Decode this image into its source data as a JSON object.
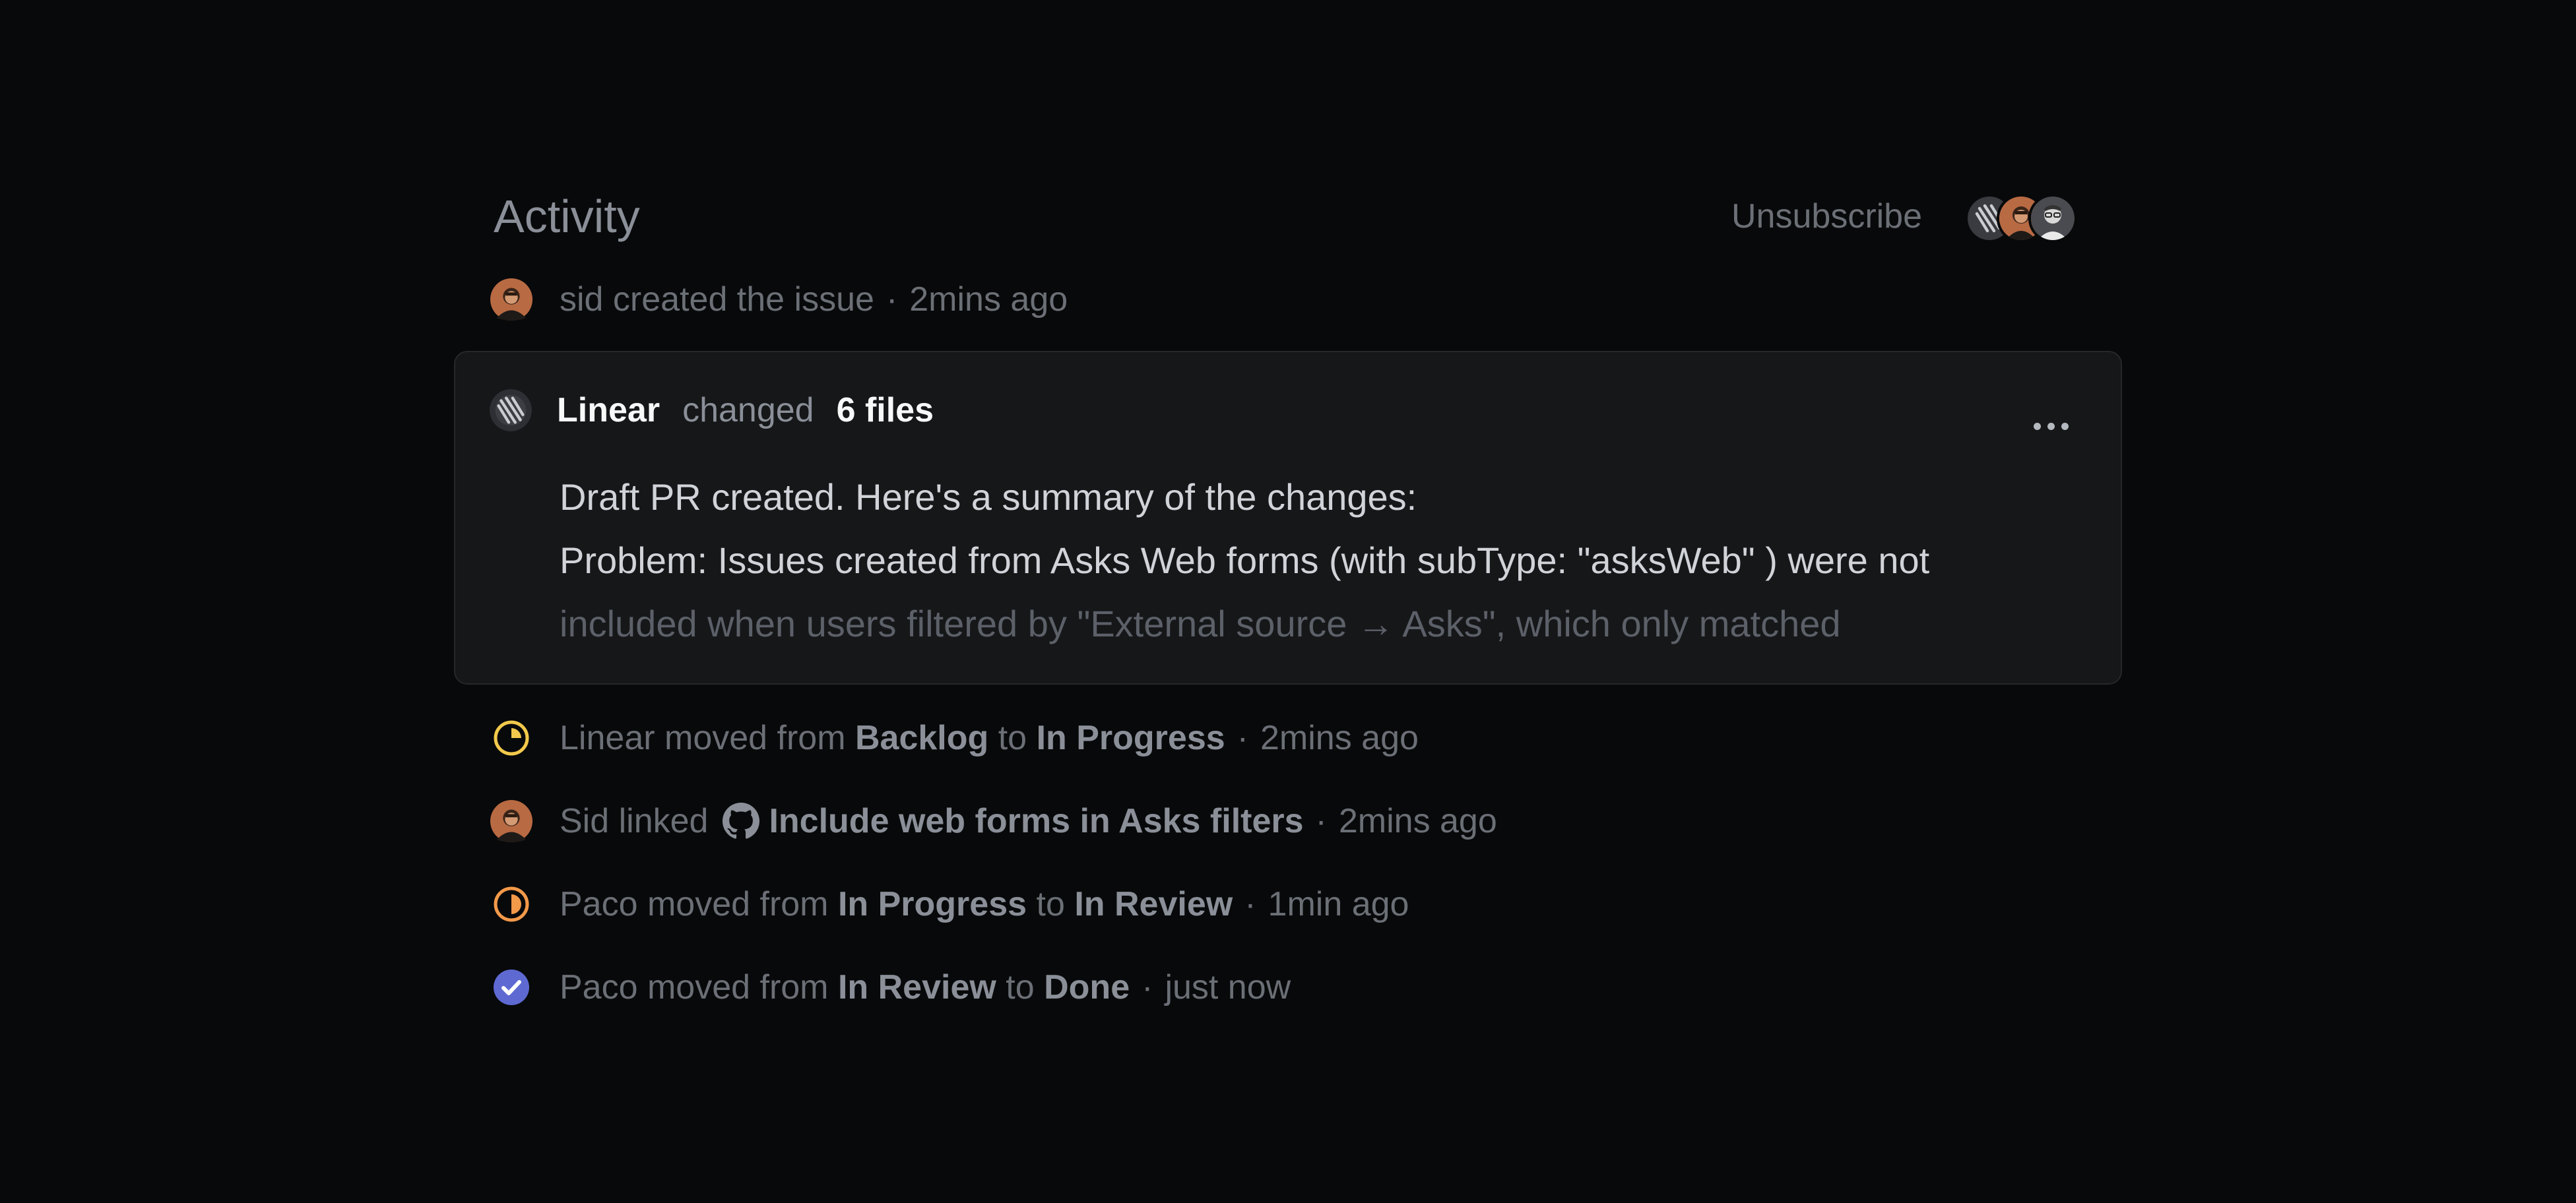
{
  "header": {
    "title": "Activity",
    "unsubscribe_label": "Unsubscribe",
    "subscribers": [
      "linear-logo",
      "sid-avatar",
      "paco-avatar"
    ]
  },
  "events": [
    {
      "id": "created",
      "actor": "sid",
      "text": "sid created the issue",
      "time": "2mins ago"
    },
    {
      "id": "moved-progress",
      "actor": "Linear",
      "text_before": "Linear moved from",
      "from": "Backlog",
      "to_word": "to",
      "to": "In Progress",
      "time": "2mins ago"
    },
    {
      "id": "linked",
      "actor": "Sid",
      "text_before": "Sid linked",
      "link": "Include web forms in Asks filters",
      "time": "2mins ago"
    },
    {
      "id": "moved-review",
      "actor": "Paco",
      "text_before": "Paco moved from",
      "from": "In Progress",
      "to_word": "to",
      "to": "In Review",
      "time": "1min ago"
    },
    {
      "id": "moved-done",
      "actor": "Paco",
      "text_before": "Paco moved from",
      "from": "In Review",
      "to_word": "to",
      "to": "Done",
      "time": "just now"
    }
  ],
  "card": {
    "author": "Linear",
    "verb": "changed",
    "files": "6 files",
    "body": [
      "Draft PR created. Here's a summary of the changes:",
      "Problem: Issues created from Asks Web forms (with subType: \"asksWeb\" ) were not",
      "included when users filtered by \"External source → Asks\", which only matched"
    ]
  },
  "colors": {
    "background": "#08090a",
    "card_background": "#161719",
    "in_progress": "#f2c94c",
    "in_review": "#f2994a",
    "done": "#5e6ad2"
  },
  "separator": "·"
}
